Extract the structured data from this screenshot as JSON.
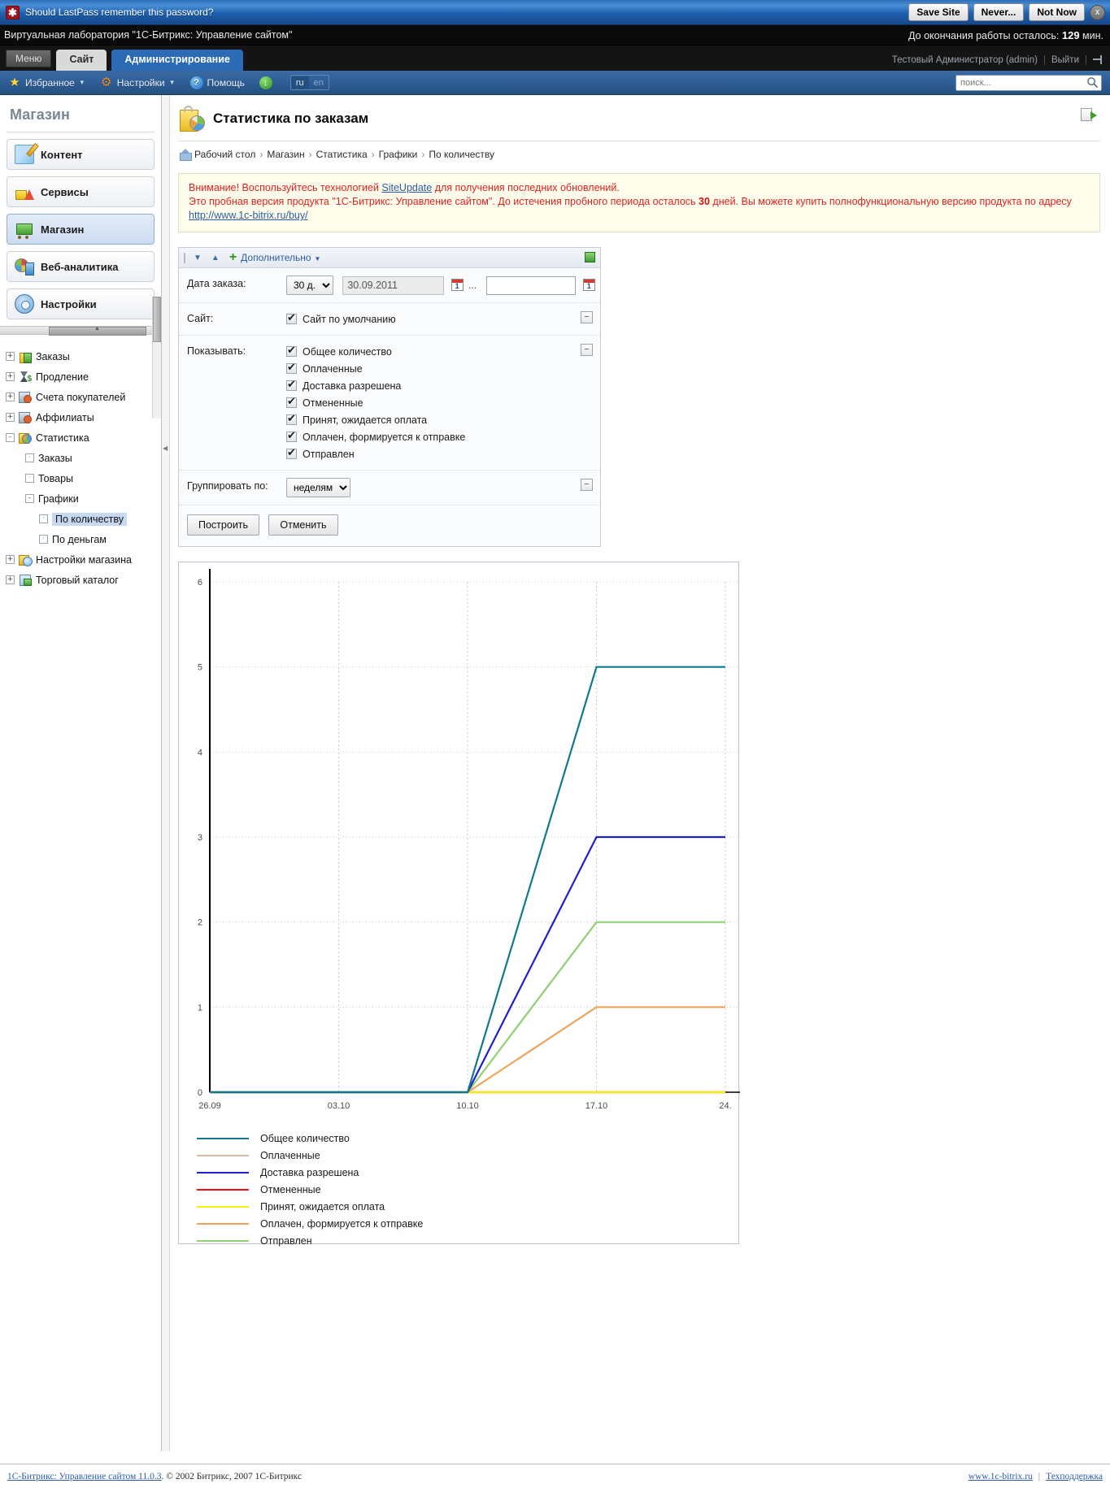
{
  "lastpass": {
    "message": "Should LastPass remember this password?",
    "logo_icon": "lastpass-asterisk-icon",
    "save_label": "Save Site",
    "never_label": "Never...",
    "not_now_label": "Not Now",
    "close_label": "x"
  },
  "vlab": {
    "title": "Виртуальная лаборатория \"1С-Битрикс: Управление сайтом\"",
    "timer_prefix": "До окончания работы осталось:",
    "timer_value": "129",
    "timer_suffix": "мин."
  },
  "tabs": {
    "menu_label": "Меню",
    "site_label": "Сайт",
    "admin_label": "Администрирование",
    "user_label": "Тестовый Администратор (admin)",
    "logout_label": "Выйти"
  },
  "toolbar": {
    "favorites_label": "Избранное",
    "settings_label": "Настройки",
    "help_label": "Помощь",
    "download_icon": "download-arrow-icon",
    "lang_ru": "ru",
    "lang_en": "en",
    "search_placeholder": "поиск..."
  },
  "sidebar": {
    "title": "Магазин",
    "modules": [
      {
        "label": "Контент",
        "icon": "content-icon",
        "selected": false
      },
      {
        "label": "Сервисы",
        "icon": "services-icon",
        "selected": false
      },
      {
        "label": "Магазин",
        "icon": "shop-cart-icon",
        "selected": true
      },
      {
        "label": "Веб-аналитика",
        "icon": "web-analytics-icon",
        "selected": false
      },
      {
        "label": "Настройки",
        "icon": "gear-icon",
        "selected": false
      }
    ],
    "tree": [
      {
        "label": "Заказы",
        "level": 1,
        "expander": "+",
        "icon": "orders-icon",
        "selected": false
      },
      {
        "label": "Продление",
        "level": 1,
        "expander": "+",
        "icon": "hourglass-icon",
        "selected": false
      },
      {
        "label": "Счета покупателей",
        "level": 1,
        "expander": "+",
        "icon": "accounts-icon",
        "selected": false
      },
      {
        "label": "Аффилиаты",
        "level": 1,
        "expander": "+",
        "icon": "accounts-icon",
        "selected": false
      },
      {
        "label": "Статистика",
        "level": 1,
        "expander": "-",
        "icon": "statistics-icon",
        "selected": false
      },
      {
        "label": "Заказы",
        "level": 2,
        "expander": "·",
        "icon": "",
        "selected": false
      },
      {
        "label": "Товары",
        "level": 2,
        "expander": "·",
        "icon": "",
        "selected": false
      },
      {
        "label": "Графики",
        "level": 2,
        "expander": "-",
        "icon": "",
        "selected": false
      },
      {
        "label": "По количеству",
        "level": 3,
        "expander": "·",
        "icon": "",
        "selected": true
      },
      {
        "label": "По деньгам",
        "level": 3,
        "expander": "·",
        "icon": "",
        "selected": false
      },
      {
        "label": "Настройки магазина",
        "level": 1,
        "expander": "+",
        "icon": "shop-settings-icon",
        "selected": false
      },
      {
        "label": "Торговый каталог",
        "level": 1,
        "expander": "+",
        "icon": "catalog-icon",
        "selected": false
      }
    ]
  },
  "page": {
    "title": "Статистика по заказам",
    "icon": "shop-statistics-icon",
    "print_icon": "export-icon",
    "breadcrumb": [
      "Рабочий стол",
      "Магазин",
      "Статистика",
      "Графики",
      "По количеству"
    ]
  },
  "warning": {
    "line1_a": "Внимание! Воспользуйтесь технологией ",
    "line1_link": "SiteUpdate",
    "line1_b": " для получения последних обновлений.",
    "line2_a": "Это пробная версия продукта \"1С-Битрикс: Управление сайтом\". До истечения пробного периода осталось ",
    "line2_days": "30",
    "line2_b": " дней. Вы можете купить полнофункциональную версию продукта по адресу ",
    "line2_link": "http://www.1c-bitrix.ru/buy/"
  },
  "filter": {
    "down_arrow": "▼",
    "up_arrow": "▲",
    "plus": "+",
    "more_label": "Дополнительно",
    "rows": {
      "date_label": "Дата заказа:",
      "date_range_selected": "30 д.",
      "date_range_options": [
        "30 д."
      ],
      "date_from": "30.09.2011",
      "date_to": "",
      "dots": "...",
      "calendar_icon": "calendar-icon",
      "site_label": "Сайт:",
      "site_checkbox": {
        "label": "Сайт по умолчанию",
        "checked": true
      },
      "show_label": "Показывать:",
      "show_checkboxes": [
        {
          "label": "Общее количество",
          "checked": true
        },
        {
          "label": "Оплаченные",
          "checked": true
        },
        {
          "label": "Доставка разрешена",
          "checked": true
        },
        {
          "label": "Отмененные",
          "checked": true
        },
        {
          "label": "Принят, ожидается оплата",
          "checked": true
        },
        {
          "label": "Оплачен, формируется к отправке",
          "checked": true
        },
        {
          "label": "Отправлен",
          "checked": true
        }
      ],
      "group_label": "Группировать по:",
      "group_selected": "неделям",
      "group_options": [
        "неделям"
      ]
    },
    "submit_label": "Построить",
    "cancel_label": "Отменить"
  },
  "chart_data": {
    "type": "line",
    "title": "",
    "xlabel": "",
    "ylabel": "",
    "grid": true,
    "legend_position": "below",
    "ylim": [
      0,
      6
    ],
    "yticks": [
      0,
      1,
      2,
      3,
      4,
      5,
      6
    ],
    "xticks": [
      "26.09",
      "03.10",
      "10.10",
      "17.10",
      "24."
    ],
    "x": [
      "26.09",
      "03.10",
      "10.10",
      "17.10",
      "24."
    ],
    "series": [
      {
        "name": "Общее количество",
        "color": "#0e7a8c",
        "values": [
          0,
          0,
          0,
          5,
          5
        ]
      },
      {
        "name": "Оплаченные",
        "color": "#d9bba0",
        "values": [
          0,
          0,
          0,
          0,
          0
        ]
      },
      {
        "name": "Доставка разрешена",
        "color": "#1f1fcc",
        "values": [
          0,
          0,
          0,
          3,
          3
        ]
      },
      {
        "name": "Отмененные",
        "color": "#ee1111",
        "values": [
          0,
          0,
          0,
          0,
          0
        ]
      },
      {
        "name": "Принят, ожидается оплата",
        "color": "#f2f20d",
        "values": [
          0,
          0,
          0,
          0,
          0
        ]
      },
      {
        "name": "Оплачен, формируется к отправке",
        "color": "#f0a45a",
        "values": [
          0,
          0,
          0,
          1,
          1
        ]
      },
      {
        "name": "Отправлен",
        "color": "#8ed173",
        "values": [
          0,
          0,
          0,
          2,
          2
        ]
      }
    ]
  },
  "footer": {
    "product_link": "1С-Битрикс: Управление сайтом 11.0.3",
    "copyright": ". © 2002 Битрикс, 2007 1С-Битрикс",
    "site_link": "www.1c-bitrix.ru",
    "support_link": "Техподдержка",
    "separator": "|"
  }
}
